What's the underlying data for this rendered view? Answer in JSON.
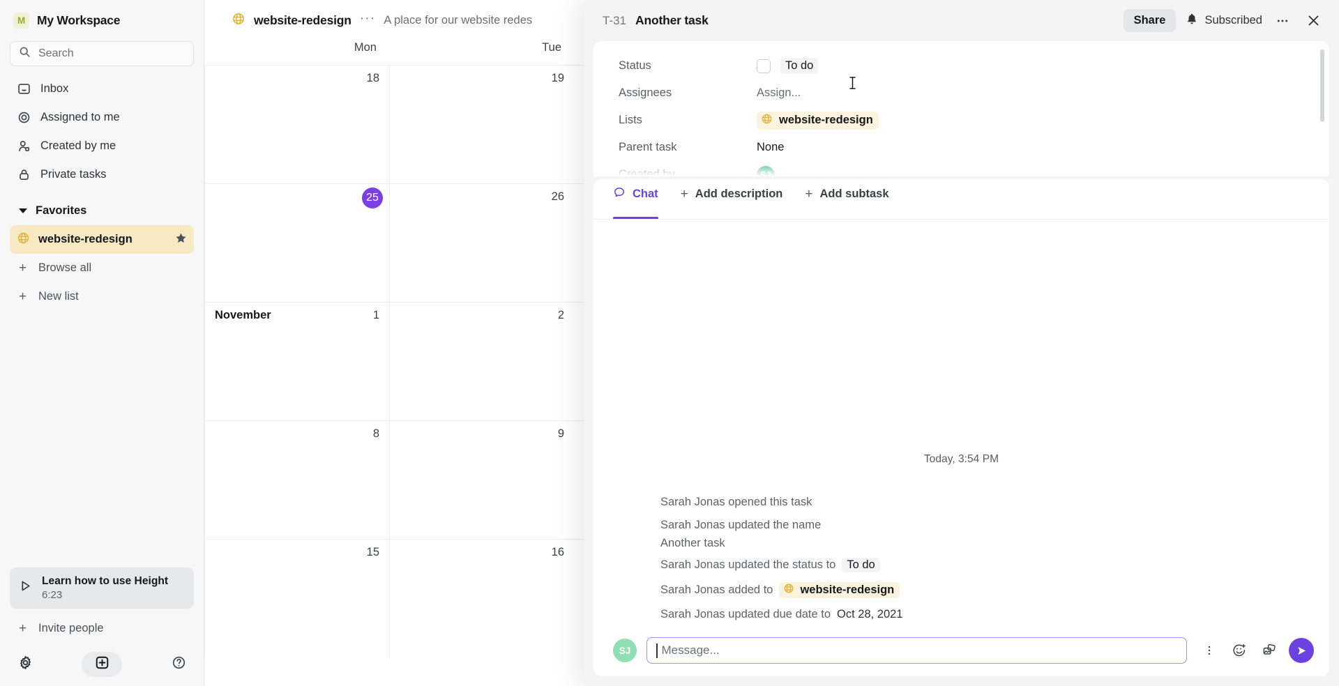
{
  "sidebar": {
    "workspace": {
      "initial": "M",
      "name": "My Workspace",
      "logo_bg": "#f2f0d8",
      "logo_color": "#99ab2e"
    },
    "search": {
      "label": "Search",
      "icon": "search-icon"
    },
    "nav": [
      {
        "label": "Inbox",
        "icon": "inbox-icon"
      },
      {
        "label": "Assigned to me",
        "icon": "target-icon"
      },
      {
        "label": "Created by me",
        "icon": "user-icon"
      },
      {
        "label": "Private tasks",
        "icon": "lock-icon"
      }
    ],
    "favorites": {
      "label": "Favorites",
      "items": [
        {
          "label": "website-redesign",
          "icon": "globe-icon",
          "starred": true,
          "highlight": "#f6e9c4"
        }
      ]
    },
    "actions": [
      {
        "label": "Browse all",
        "icon": "plus-icon"
      },
      {
        "label": "New list",
        "icon": "plus-icon"
      }
    ],
    "learn_card": {
      "title": "Learn how to use Height",
      "duration": "6:23",
      "icon": "play-icon"
    },
    "invite": {
      "label": "Invite people",
      "icon": "plus-icon"
    },
    "footer": [
      {
        "name": "settings",
        "icon": "gear-icon"
      },
      {
        "name": "new",
        "icon": "plus-square-icon"
      },
      {
        "name": "help",
        "icon": "question-circle-icon"
      }
    ]
  },
  "calendar": {
    "list_name": "website-redesign",
    "list_icon": "globe-icon",
    "more_label": "···",
    "description": "A place for our website redes",
    "weekdays": [
      "Mon",
      "Tue"
    ],
    "weeks": [
      {
        "cells": [
          {
            "month": "",
            "day": "18",
            "today": false
          },
          {
            "month": "",
            "day": "19",
            "today": false
          }
        ]
      },
      {
        "cells": [
          {
            "month": "",
            "day": "25",
            "today": true
          },
          {
            "month": "",
            "day": "26",
            "today": false
          }
        ]
      },
      {
        "cells": [
          {
            "month": "November",
            "day": "1",
            "today": false
          },
          {
            "month": "",
            "day": "2",
            "today": false
          }
        ]
      },
      {
        "cells": [
          {
            "month": "",
            "day": "8",
            "today": false
          },
          {
            "month": "",
            "day": "9",
            "today": false
          }
        ]
      },
      {
        "cells": [
          {
            "month": "",
            "day": "15",
            "today": false
          },
          {
            "month": "",
            "day": "16",
            "today": false
          }
        ]
      }
    ],
    "today_color": "#7b3fe4"
  },
  "task_panel": {
    "key": "T-31",
    "title": "Another task",
    "share_label": "Share",
    "subscribed_label": "Subscribed",
    "bell_icon": "bell-icon",
    "more_icon": "ellipsis-icon",
    "close_icon": "close-icon",
    "properties": [
      {
        "label": "Status",
        "type": "status",
        "value": "To do"
      },
      {
        "label": "Assignees",
        "type": "muted",
        "value": "Assign..."
      },
      {
        "label": "Lists",
        "type": "list-chip",
        "value": "website-redesign"
      },
      {
        "label": "Parent task",
        "type": "plain",
        "value": "None"
      },
      {
        "label": "Created by",
        "type": "avatar",
        "value": "SJ"
      }
    ],
    "tabs": [
      {
        "label": "Chat",
        "icon": "chat-bubble-icon",
        "active": true
      },
      {
        "label": "Add description",
        "icon": "plus-icon",
        "active": false
      },
      {
        "label": "Add subtask",
        "icon": "plus-icon",
        "active": false
      }
    ],
    "chat": {
      "daystamp": "Today, 3:54 PM",
      "events": [
        {
          "text": "Sarah Jonas opened this task"
        },
        {
          "text": "Sarah Jonas updated the name"
        },
        {
          "text": "Another task",
          "tight": true
        },
        {
          "text": "Sarah Jonas updated the status to",
          "chip": "To do",
          "chip_type": "status"
        },
        {
          "text": "Sarah Jonas added to",
          "chip": "website-redesign",
          "chip_type": "list"
        },
        {
          "text": "Sarah Jonas updated due date to",
          "suffix": "Oct 28, 2021"
        }
      ]
    },
    "composer": {
      "avatar": "SJ",
      "placeholder": "Message...",
      "tools": [
        {
          "name": "more-options",
          "icon": "vertical-ellipsis-icon"
        },
        {
          "name": "emoji",
          "icon": "emoji-plus-icon"
        },
        {
          "name": "attachment",
          "icon": "images-icon"
        }
      ],
      "send_icon": "send-icon",
      "accent": "#6b41e0"
    }
  }
}
